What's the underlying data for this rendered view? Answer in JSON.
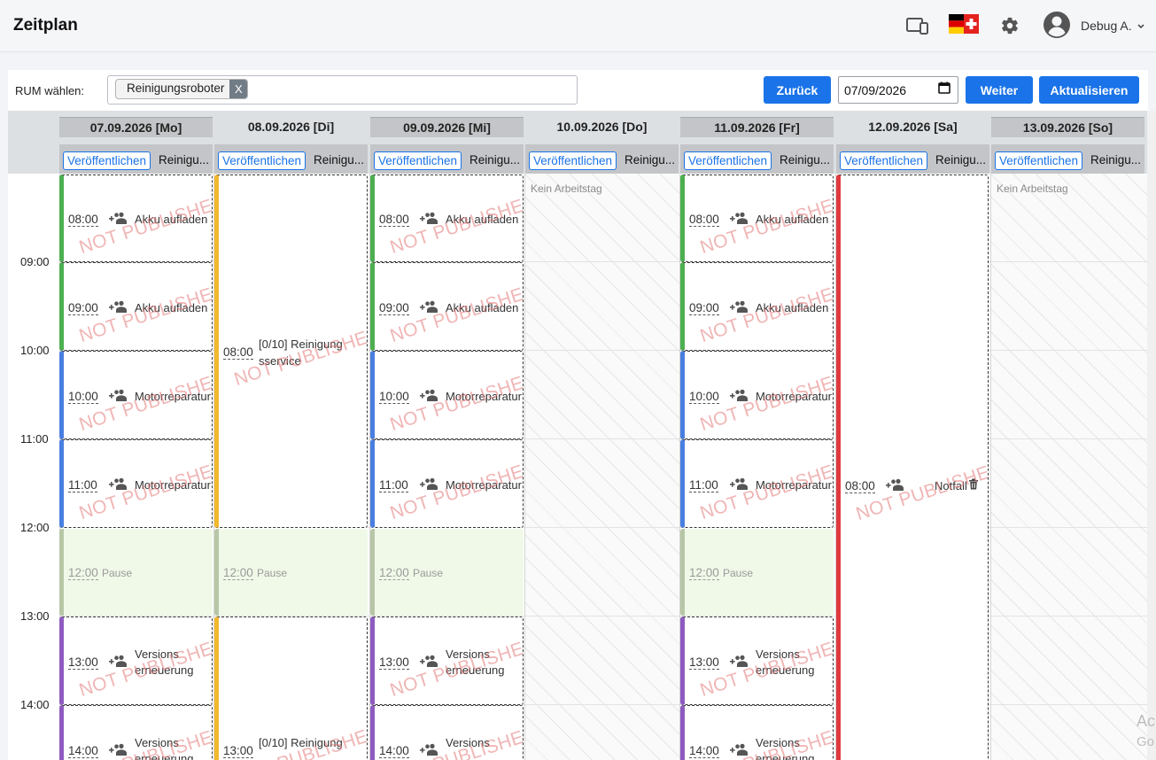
{
  "header": {
    "title": "Zeitplan",
    "user": "Debug A.",
    "colors": {
      "accent": "#1a73e8"
    },
    "icons": [
      "devices-icon",
      "flag-icon",
      "gear-icon",
      "account-icon",
      "chevron-down-icon"
    ]
  },
  "controls": {
    "rum_label": "RUM wählen:",
    "rum_chip": "Reinigungsroboter",
    "rum_chip_remove": "X",
    "back": "Zurück",
    "date": "07/09/2026",
    "next": "Weiter",
    "refresh": "Aktualisieren"
  },
  "days": [
    {
      "title": "07.09.2026 [Mo]",
      "publish": "Veröffentlichen",
      "sub": "Reinigu..."
    },
    {
      "title": "08.09.2026 [Di]",
      "publish": "Veröffentlichen",
      "sub": "Reinigu..."
    },
    {
      "title": "09.09.2026 [Mi]",
      "publish": "Veröffentlichen",
      "sub": "Reinigu..."
    },
    {
      "title": "10.09.2026 [Do]",
      "publish": "Veröffentlichen",
      "sub": "Reinigu..."
    },
    {
      "title": "11.09.2026 [Fr]",
      "publish": "Veröffentlichen",
      "sub": "Reinigu..."
    },
    {
      "title": "12.09.2026 [Sa]",
      "publish": "Veröffentlichen",
      "sub": "Reinigu..."
    },
    {
      "title": "13.09.2026 [So]",
      "publish": "Veröffentlichen",
      "sub": "Reinigu..."
    }
  ],
  "hours": [
    "09:00",
    "10:00",
    "11:00",
    "12:00",
    "13:00",
    "14:00"
  ],
  "no_workday": "Kein Arbeitstag",
  "watermark": "NOT PUBLISHED",
  "events": {
    "akku_time_1": "08:00",
    "akku_time_2": "09:00",
    "akku_title": "Akku aufladen",
    "motor_time_1": "10:00",
    "motor_time_2": "11:00",
    "motor_title": "Motorreparatur",
    "pause_time": "12:00",
    "pause_title": "Pause",
    "version_time_1": "13:00",
    "version_time_2": "14:00",
    "version_title_1": "Versions",
    "version_title_2": "erneuerung",
    "service_time_1": "08:00",
    "service_time_2": "13:00",
    "service_title_1": "[0/10] Reinigung",
    "service_title_2": "sservice",
    "notfall_time": "08:00",
    "notfall_title": "Notfall"
  },
  "event_colors": {
    "akku": "#4caf50",
    "motor": "#4a7fe0",
    "pause": "#b7c6a6",
    "version": "#8e5cc0",
    "service": "#f2b92e",
    "notfall": "#e0393e"
  },
  "overlay": {
    "activate_1": "Ac",
    "activate_2": "Go"
  }
}
